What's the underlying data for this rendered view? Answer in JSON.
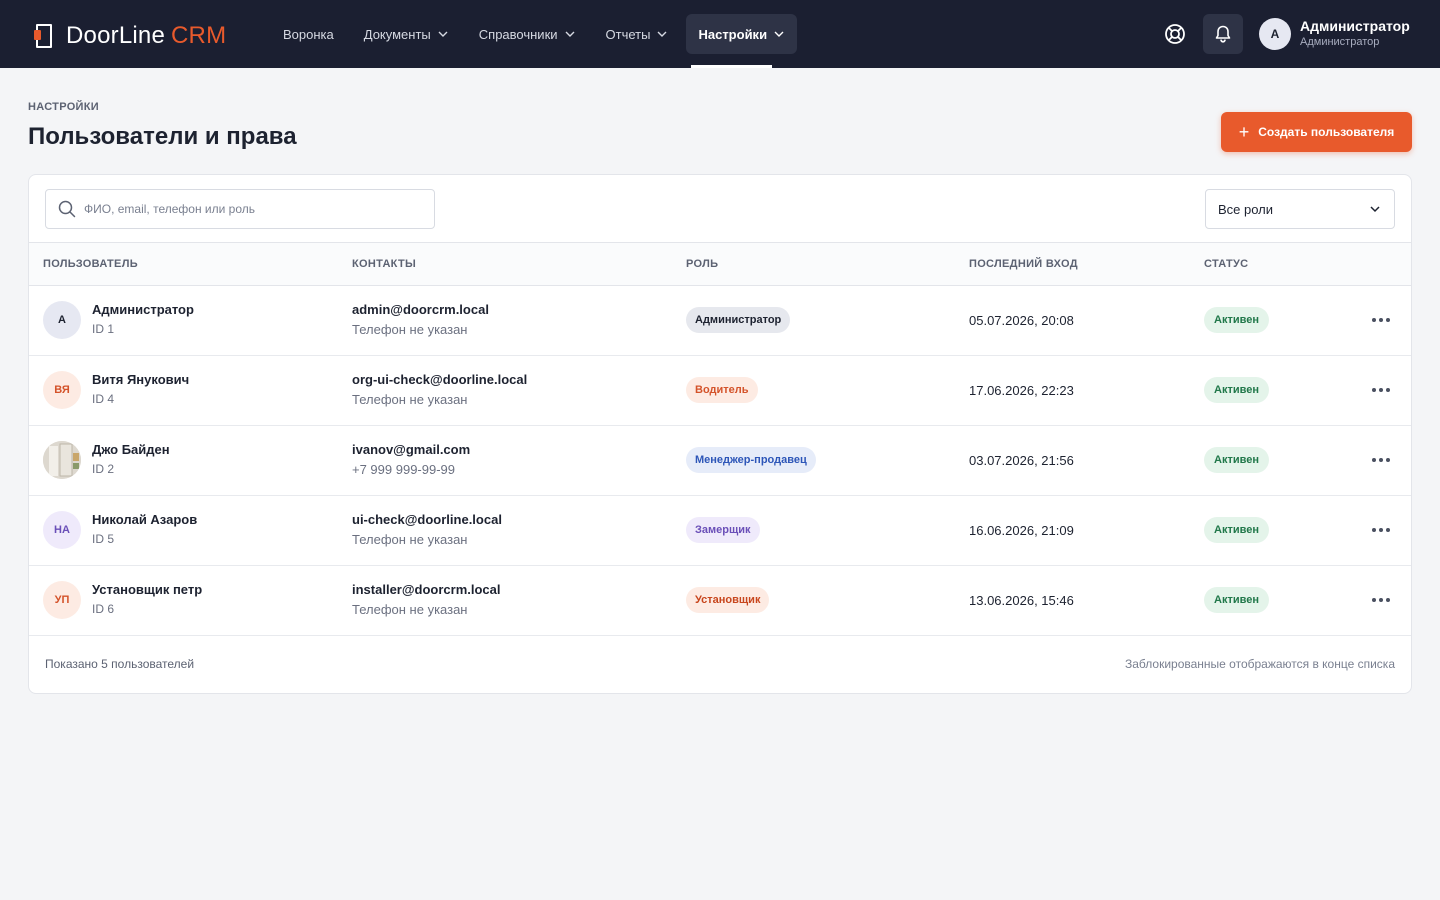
{
  "app": {
    "logo_main": "DoorLine",
    "logo_accent": "CRM",
    "accent_color": "#e85a2c"
  },
  "nav": [
    {
      "label": "Воронка",
      "dropdown": false,
      "active": false
    },
    {
      "label": "Документы",
      "dropdown": true,
      "active": false
    },
    {
      "label": "Справочники",
      "dropdown": true,
      "active": false
    },
    {
      "label": "Отчеты",
      "dropdown": true,
      "active": false
    },
    {
      "label": "Настройки",
      "dropdown": true,
      "active": true
    }
  ],
  "header_icons": [
    "lifebuoy-icon",
    "bell-icon"
  ],
  "current_user": {
    "initials": "А",
    "name": "Администратор",
    "role": "Администратор"
  },
  "page": {
    "breadcrumb": "НАСТРОЙКИ",
    "title": "Пользователи и права",
    "create_button": "Создать пользователя"
  },
  "filters": {
    "search_placeholder": "ФИО, email, телефон или роль",
    "search_value": "",
    "role_select": "Все роли"
  },
  "table": {
    "columns": [
      "ПОЛЬЗОВАТЕЛЬ",
      "КОНТАКТЫ",
      "РОЛЬ",
      "ПОСЛЕДНИЙ ВХОД",
      "СТАТУС"
    ],
    "rows": [
      {
        "initials": "А",
        "avatar_bg": "#e6e8f2",
        "avatar_fg": "#1d2230",
        "photo": false,
        "name": "Администратор",
        "id": "ID 1",
        "email": "admin@doorcrm.local",
        "phone": "Телефон не указан",
        "role": "Администратор",
        "role_bg": "#e6e8ee",
        "role_fg": "#1d2230",
        "last_login": "05.07.2026, 20:08",
        "status": "Активен"
      },
      {
        "initials": "ВЯ",
        "avatar_bg": "#fdebe3",
        "avatar_fg": "#d4532a",
        "photo": false,
        "name": "Витя Янукович",
        "id": "ID 4",
        "email": "org-ui-check@doorline.local",
        "phone": "Телефон не указан",
        "role": "Водитель",
        "role_bg": "#fdebe3",
        "role_fg": "#d4532a",
        "last_login": "17.06.2026, 22:23",
        "status": "Активен"
      },
      {
        "initials": "",
        "avatar_bg": "#d9d4cb",
        "avatar_fg": "#1d2230",
        "photo": true,
        "name": "Джо Байден",
        "id": "ID 2",
        "email": "ivanov@gmail.com",
        "phone": "+7 999 999-99-99",
        "role": "Менеджер-продавец",
        "role_bg": "#e6ecf9",
        "role_fg": "#2d56b8",
        "last_login": "03.07.2026, 21:56",
        "status": "Активен"
      },
      {
        "initials": "НА",
        "avatar_bg": "#efeafb",
        "avatar_fg": "#6a4fb8",
        "photo": false,
        "name": "Николай Азаров",
        "id": "ID 5",
        "email": "ui-check@doorline.local",
        "phone": "Телефон не указан",
        "role": "Замерщик",
        "role_bg": "#efeafb",
        "role_fg": "#6a4fb8",
        "last_login": "16.06.2026, 21:09",
        "status": "Активен"
      },
      {
        "initials": "УП",
        "avatar_bg": "#fdebe3",
        "avatar_fg": "#d4532a",
        "photo": false,
        "name": "Установщик петр",
        "id": "ID 6",
        "email": "installer@doorcrm.local",
        "phone": "Телефон не указан",
        "role": "Установщик",
        "role_bg": "#fdebe3",
        "role_fg": "#c8461d",
        "last_login": "13.06.2026, 15:46",
        "status": "Активен"
      }
    ]
  },
  "footer": {
    "count_text": "Показано 5 пользователей",
    "note": "Заблокированные отображаются в конце списка"
  }
}
